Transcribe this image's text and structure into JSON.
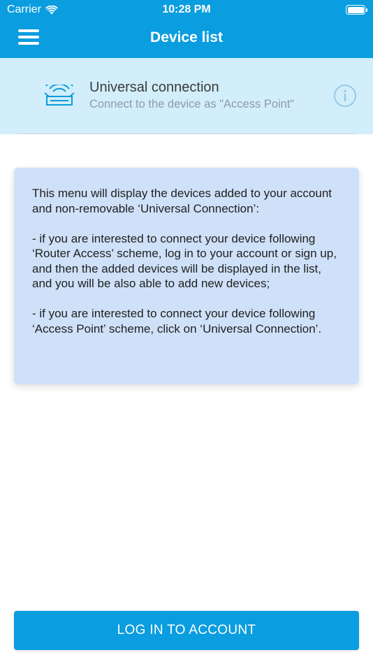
{
  "status_bar": {
    "carrier": "Carrier",
    "time": "10:28 PM",
    "wifi_icon": "wifi-icon",
    "battery_icon": "battery-icon"
  },
  "nav": {
    "title": "Device list",
    "menu_icon": "hamburger-menu-icon"
  },
  "universal_connection": {
    "icon": "router-wifi-icon",
    "title": "Universal connection",
    "subtitle": "Connect to the device as \"Access Point\"",
    "info_icon": "info-icon"
  },
  "message": {
    "paragraph_1": "This menu will display the devices added to your account and non-removable ‘Universal Connection’:",
    "paragraph_2": "- if you are interested to connect your device following ‘Router Access’ scheme, log in to your account or sign up, and then the added devices will be displayed in the list, and you will be also able to add new devices;",
    "paragraph_3": "- if you are interested to connect your device following ‘Access Point’ scheme, click on ‘Universal Connection’."
  },
  "login_button": {
    "label": "LOG IN TO ACCOUNT"
  },
  "colors": {
    "primary": "#0a9ddf",
    "row_background": "#d2eefb",
    "message_background": "#cfe1f8"
  }
}
